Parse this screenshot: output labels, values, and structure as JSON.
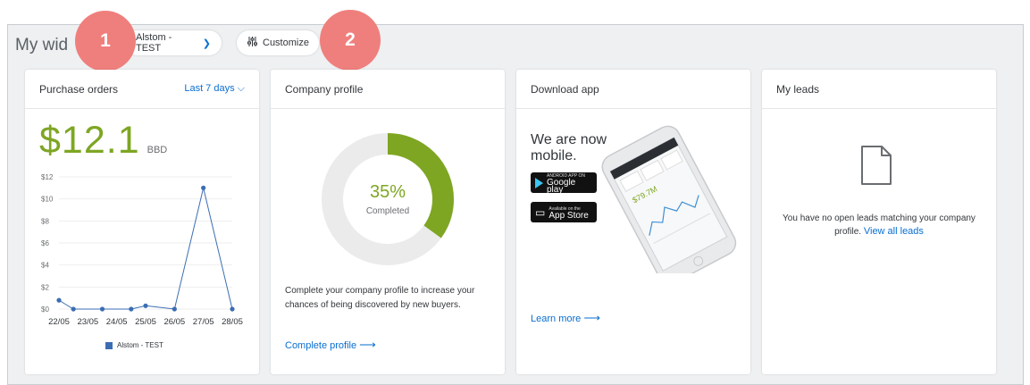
{
  "header": {
    "title": "My widgets",
    "company_selector": "Alstom - TEST",
    "customize_label": "Customize"
  },
  "badges": [
    "1",
    "2"
  ],
  "purchase_orders": {
    "title": "Purchase orders",
    "period": "Last 7 days",
    "amount": "$12.1",
    "currency": "BBD",
    "legend": "Alstom - TEST"
  },
  "chart_data": {
    "type": "line",
    "categories": [
      "22/05",
      "23/05",
      "24/05",
      "25/05",
      "26/05",
      "27/05",
      "28/05"
    ],
    "x_positions": [
      0,
      0.5,
      1.5,
      2.5,
      3,
      4,
      5,
      6
    ],
    "series": [
      {
        "name": "Alstom - TEST",
        "values": [
          0.8,
          0,
          0,
          0,
          0.3,
          0,
          11,
          0
        ],
        "color": "#3b6db3"
      }
    ],
    "ylim": [
      0,
      12
    ],
    "y_ticks": [
      "$0",
      "$2",
      "$4",
      "$6",
      "$8",
      "$10",
      "$12"
    ],
    "grid": true,
    "legend": "bottom"
  },
  "company_profile": {
    "title": "Company profile",
    "percent": "35%",
    "percent_value": 0.35,
    "completed_label": "Completed",
    "description": "Complete your company profile to increase your chances of being discovered by new buyers.",
    "link": "Complete profile"
  },
  "download_app": {
    "title": "Download app",
    "headline_1": "We are now",
    "headline_2": "mobile.",
    "google_small": "ANDROID APP ON",
    "google_big": "Google play",
    "apple_small": "Available on the",
    "apple_big": "App Store",
    "phone_amount": "$79.7M",
    "link": "Learn more"
  },
  "my_leads": {
    "title": "My leads",
    "message": "You have no open leads matching your company profile.",
    "link": "View all leads"
  },
  "colors": {
    "accent_green": "#7ea623",
    "link_blue": "#0a6ed1",
    "badge": "#ef7f7c",
    "series_blue": "#3b6db3",
    "donut_track": "#ebebeb"
  }
}
